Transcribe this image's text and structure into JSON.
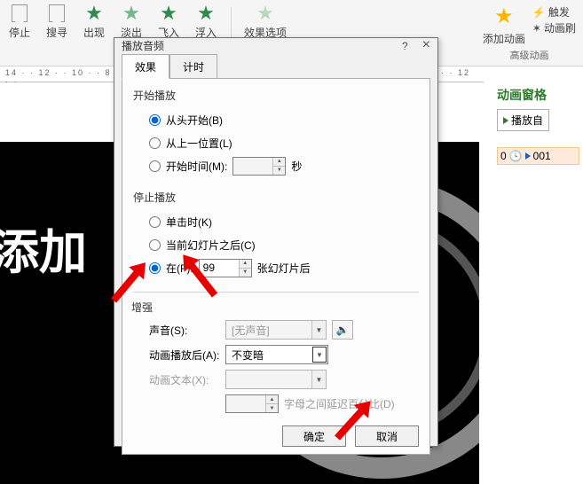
{
  "ribbon": {
    "items": [
      {
        "label": "停止",
        "color": "#999"
      },
      {
        "label": "搜寻",
        "color": "#999"
      },
      {
        "label": "出现",
        "color": "#2f8a4d"
      },
      {
        "label": "淡出",
        "color": "#2f8a4d"
      },
      {
        "label": "飞入",
        "color": "#2f8a4d"
      },
      {
        "label": "浮入",
        "color": "#2f8a4d"
      }
    ],
    "effect_options": "效果选项",
    "add_anim": "添加动画",
    "trigger": "触发",
    "anim_brush": "动画刷",
    "group_advanced": "高级动画"
  },
  "ruler_text": "14 · · 12 · · 10 · · 8 · · · 6 · · · 4 · · · 2 · · · 0 · · · 2 · · · 4 · · · 6 · · · 8 · · · 10 · · 12 · ·",
  "slide": {
    "text": "添加"
  },
  "anim_pane": {
    "title": "动画窗格",
    "play_from": "播放自",
    "item_index": "0",
    "item_name": "001"
  },
  "dialog": {
    "title": "播放音频",
    "help": "?",
    "close": "×",
    "tabs": {
      "effect": "效果",
      "timing": "计时"
    },
    "start_play": {
      "legend": "开始播放",
      "from_begin": "从头开始(B)",
      "from_last": "从上一位置(L)",
      "start_time": "开始时间(M):",
      "start_time_val": "",
      "sec": "秒"
    },
    "stop_play": {
      "legend": "停止播放",
      "on_click": "单击时(K)",
      "after_current": "当前幻灯片之后(C)",
      "after_f": "在(F):",
      "after_f_val": "99",
      "after_f_suffix": "张幻灯片后"
    },
    "enhance": {
      "legend": "增强",
      "sound": "声音(S):",
      "sound_val": "[无声音]",
      "after_anim": "动画播放后(A):",
      "after_anim_val": "不变暗",
      "anim_text": "动画文本(X):",
      "anim_text_val": "",
      "delay_val": "",
      "delay_suffix": "字母之间延迟百分比(D)"
    },
    "ok": "确定",
    "cancel": "取消"
  }
}
